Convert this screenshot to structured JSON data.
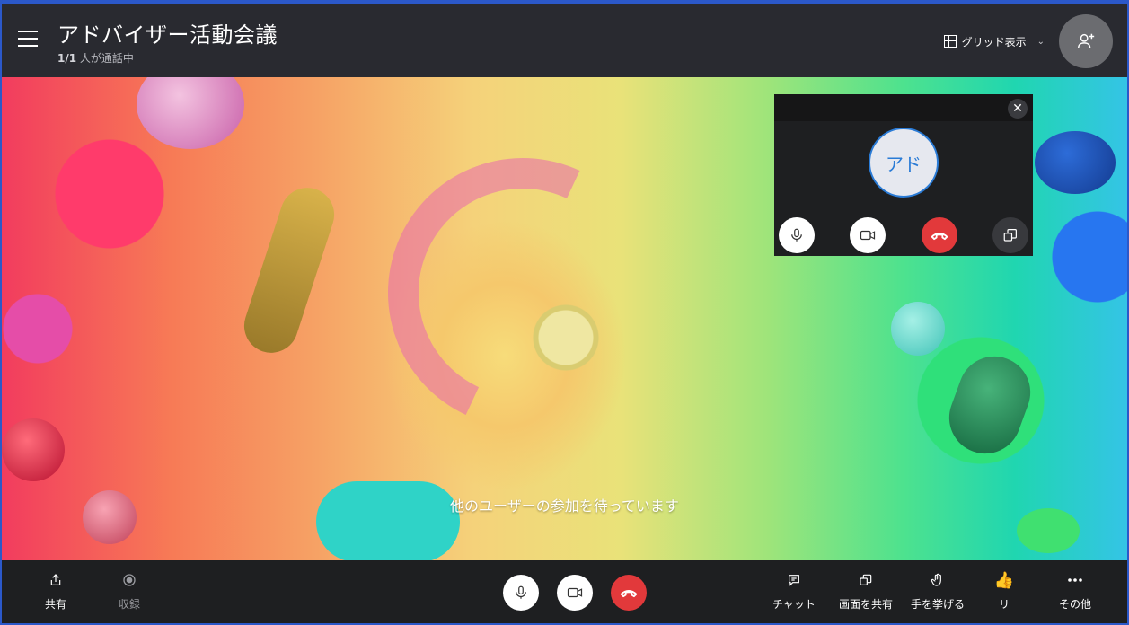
{
  "header": {
    "title": "アドバイザー活動会議",
    "participants_count": "1/1",
    "participants_suffix": " 人が通話中",
    "grid_toggle_label": "グリッド表示"
  },
  "stage": {
    "waiting_text": "他のユーザーの参加を待っています"
  },
  "self_preview": {
    "avatar_initials": "アド",
    "close_glyph": "✕"
  },
  "toolbar": {
    "share_label": "共有",
    "record_label": "収録",
    "chat_label": "チャット",
    "screen_share_label": "画面を共有",
    "raise_hand_label": "手を挙げる",
    "react_label": "リ",
    "more_label": "その他",
    "react_emoji": "👍"
  },
  "colors": {
    "header_bg": "#292a30",
    "toolbar_bg": "#1e1f21",
    "hangup_red": "#e2393b",
    "avatar_blue": "#2a7bd6",
    "frame_blue": "#2b58c9"
  },
  "icons": [
    "menu-icon",
    "grid-icon",
    "add-person-icon",
    "microphone-icon",
    "video-camera-icon",
    "hang-up-icon",
    "switch-camera-icon",
    "share-icon",
    "record-icon",
    "chat-icon",
    "screen-share-icon",
    "raise-hand-icon",
    "thumbs-up-icon",
    "more-icon"
  ]
}
